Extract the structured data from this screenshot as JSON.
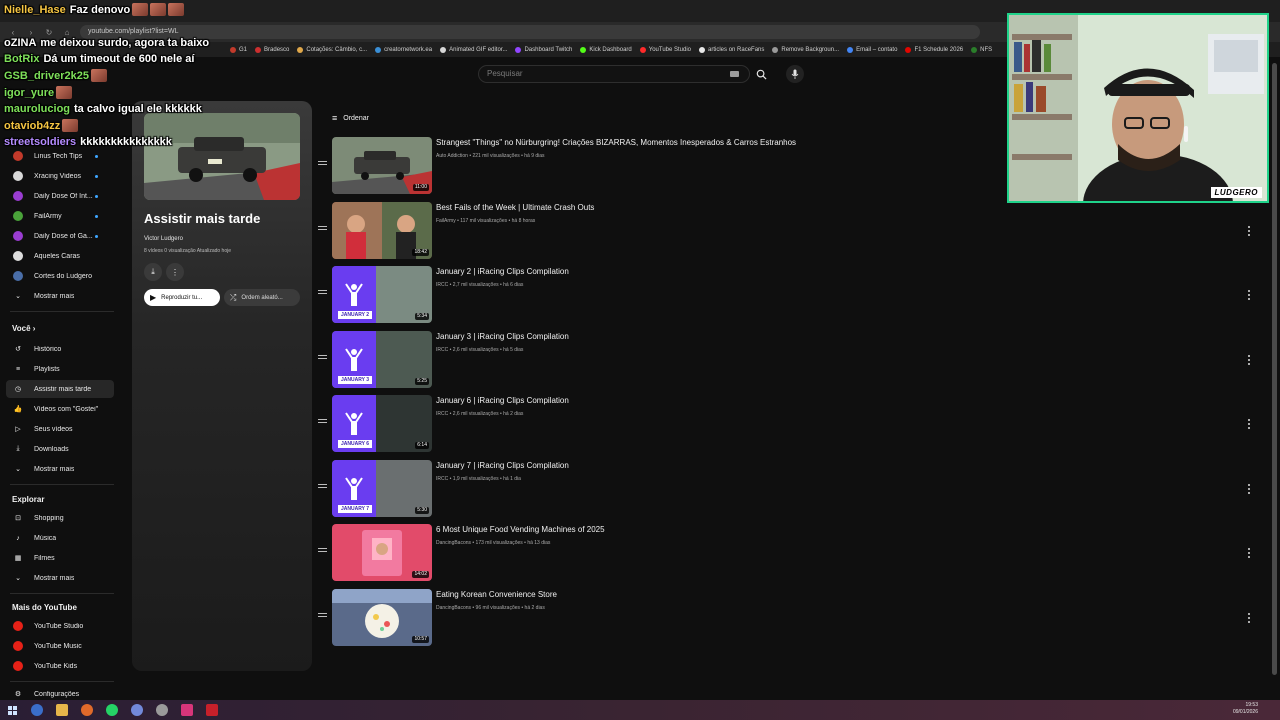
{
  "browser": {
    "url": "youtube.com/playlist?list=WL",
    "bookmarks": [
      "G1",
      "Bradesco",
      "Cotações: Câmbio, c...",
      "creatornetwork.ea",
      "Animated GIF editor...",
      "Dashboard Twitch",
      "Kick Dashboard",
      "YouTube Studio",
      "articles on RaceFans",
      "Remove Backgroun...",
      "Email – contato",
      "F1 Schedule 2026",
      "NFS"
    ]
  },
  "search": {
    "placeholder": "Pesquisar"
  },
  "sidebar": {
    "subscriptions": [
      {
        "label": "Linus Tech Tips",
        "color": "#c23a2b"
      },
      {
        "label": "Xracing Videos",
        "color": "#d9d9d9"
      },
      {
        "label": "Daily Dose Of Int...",
        "color": "#9a3dd1"
      },
      {
        "label": "FailArmy",
        "color": "#4aa33a"
      },
      {
        "label": "Daily Dose of Ga...",
        "color": "#9a3dd1"
      },
      {
        "label": "Aqueles Caras",
        "color": "#dddddd"
      },
      {
        "label": "Cortes do Ludgero",
        "color": "#4a6ea8"
      }
    ],
    "show_more_1": "Mostrar mais",
    "you_section": "Você",
    "you_items": [
      "Histórico",
      "Playlists",
      "Assistir mais tarde",
      "Vídeos com \"Gostei\"",
      "Seus vídeos",
      "Downloads",
      "Mostrar mais"
    ],
    "explore_section": "Explorar",
    "explore_items": [
      "Shopping",
      "Música",
      "Filmes",
      "Mostrar mais"
    ],
    "more_section": "Mais do YouTube",
    "more_items": [
      "YouTube Studio",
      "YouTube Music",
      "YouTube Kids"
    ],
    "settings_label": "Configurações"
  },
  "playlist": {
    "title": "Assistir mais tarde",
    "owner": "Victor Ludgero",
    "meta": "8 vídeos   0 visualização   Atualizado hoje",
    "play_all": "Reproduzir tu...",
    "shuffle": "Ordem aleató...",
    "sort_label": "Ordenar"
  },
  "videos": [
    {
      "title": "Strangest \"Things\" no Nürburgring! Criações BIZARRAS, Momentos Inesperados & Carros Estranhos",
      "meta": "Auto Addiction • 221 mil visualizações • há 9 dias",
      "duration": "11:00"
    },
    {
      "title": "Best Fails of the Week | Ultimate Crash Outs",
      "meta": "FailArmy • 117 mil visualizações • há 8 horas",
      "duration": "18:42"
    },
    {
      "title": "January 2 | iRacing Clips Compilation",
      "meta": "IRCC • 2,7 mil visualizações • há 6 dias",
      "duration": "5:34",
      "tag": "JANUARY 2"
    },
    {
      "title": "January 3 | iRacing Clips Compilation",
      "meta": "IRCC • 2,6 mil visualizações • há 5 dias",
      "duration": "5:25",
      "tag": "JANUARY 3"
    },
    {
      "title": "January 6 | iRacing Clips Compilation",
      "meta": "IRCC • 2,6 mil visualizações • há 2 dias",
      "duration": "6:14",
      "tag": "JANUARY 6"
    },
    {
      "title": "January 7 | iRacing Clips Compilation",
      "meta": "IRCC • 1,9 mil visualizações • há 1 dia",
      "duration": "5:30",
      "tag": "JANUARY 7"
    },
    {
      "title": "6 Most Unique Food Vending Machines of 2025",
      "meta": "DancingBacons • 173 mil visualizações • há 13 dias",
      "duration": "14:02"
    },
    {
      "title": "Eating Korean Convenience Store",
      "meta": "DancingBacons • 96 mil visualizações • há 2 dias",
      "duration": "10:57"
    }
  ],
  "chat": [
    {
      "user": "Nielle_Hase",
      "color": "#f5c542",
      "msg": "Faz denovo"
    },
    {
      "user": "oZINA",
      "color": "#ffffff",
      "msg": "me deixou surdo, agora ta baixo"
    },
    {
      "user": "BotRix",
      "color": "#7ee05a",
      "msg": "Dá um timeout de 600 nele aí"
    },
    {
      "user": "GSB_driver2k25",
      "color": "#7ee05a",
      "msg": ""
    },
    {
      "user": "igor_yure",
      "color": "#7ee05a",
      "msg": ""
    },
    {
      "user": "mauroluciog",
      "color": "#7ee05a",
      "msg": "ta calvo igual ele kkkkkk"
    },
    {
      "user": "otaviob4zz",
      "color": "#f5c542",
      "msg": ""
    },
    {
      "user": "streetsoldiers",
      "color": "#b48bff",
      "msg": "kkkkkkkkkkkkkkk"
    }
  ],
  "webcam": {
    "brand": "LUDGERO"
  },
  "taskbar": {
    "time": "19:53",
    "date": "09/01/2026"
  }
}
